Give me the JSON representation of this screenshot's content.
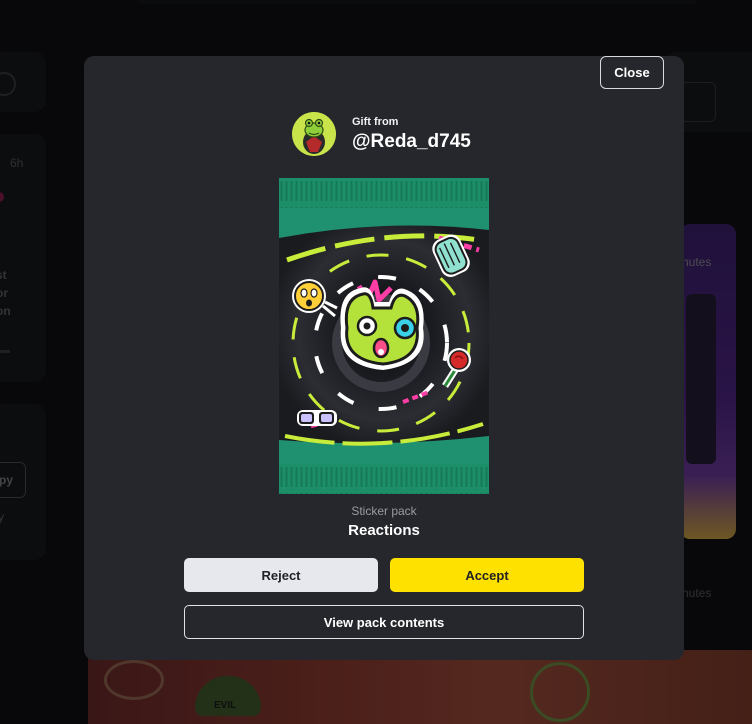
{
  "background": {
    "left_badge_time": "6h",
    "left_text_lines": [
      "st",
      "or",
      "on"
    ],
    "left_button_label": "py",
    "left_sub_text": "y",
    "right_text_top": "nutes",
    "right_text_bottom": "nutes",
    "banner_sign_text": "EVIL"
  },
  "modal": {
    "close_label": "Close",
    "gift_from_label": "Gift from",
    "username": "@Reda_d745",
    "pack_type": "Sticker pack",
    "pack_name": "Reactions",
    "reject_label": "Reject",
    "accept_label": "Accept",
    "view_contents_label": "View pack contents"
  },
  "colors": {
    "modal_bg": "#26272c",
    "accept": "#ffe100",
    "reject": "#e7e7ee",
    "pack_green": "#1f8f6a",
    "sticker_lime": "#b5e23a",
    "sticker_pink": "#ff3da6"
  },
  "icons": {
    "avatar": "frog-avatar-icon",
    "sticker_main": "frog-face-sticker-icon",
    "sticker_hands": "clapping-hands-sticker-icon",
    "sticker_smiley": "worried-smiley-sticker-icon",
    "sticker_rose": "rose-sticker-icon",
    "sticker_glasses": "glasses-sticker-icon"
  }
}
